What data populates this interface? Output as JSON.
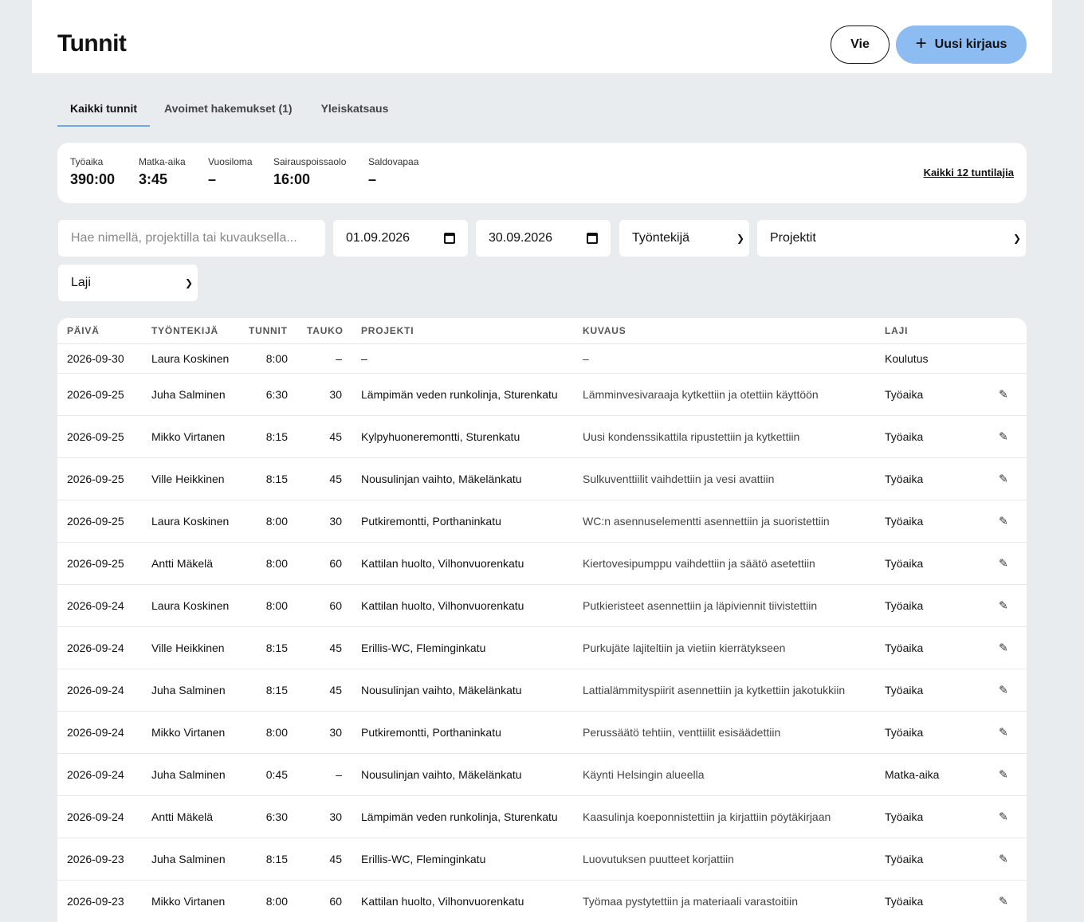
{
  "header": {
    "title": "Tunnit",
    "export_label": "Vie",
    "new_entry_label": "Uusi kirjaus",
    "plus_glyph": "+"
  },
  "tabs": [
    {
      "label": "Kaikki tunnit",
      "active": true
    },
    {
      "label": "Avoimet hakemukset (1)",
      "active": false
    },
    {
      "label": "Yleiskatsaus",
      "active": false
    }
  ],
  "summary": {
    "stats": [
      {
        "label": "Työaika",
        "value": "390:00"
      },
      {
        "label": "Matka-aika",
        "value": "3:45"
      },
      {
        "label": "Vuosiloma",
        "value": "–"
      },
      {
        "label": "Sairauspoissaolo",
        "value": "16:00"
      },
      {
        "label": "Saldovapaa",
        "value": "–"
      }
    ],
    "all_types_link": "Kaikki 12 tuntilajia"
  },
  "filters": {
    "search_placeholder": "Hae nimellä, projektilla tai kuvauksella...",
    "date_from": "01.09.2026",
    "date_to": "30.09.2026",
    "employee_select": "Työntekijä",
    "project_select": "Projektit",
    "type_select": "Laji"
  },
  "table": {
    "columns": [
      "PÄIVÄ",
      "TYÖNTEKIJÄ",
      "TUNNIT",
      "TAUKO",
      "PROJEKTI",
      "KUVAUS",
      "LAJI"
    ],
    "rows": [
      {
        "date": "2026-09-30",
        "employee": "Laura Koskinen",
        "hours": "8:00",
        "break": "–",
        "project": "–",
        "description": "–",
        "type": "Koulutus",
        "editable": false
      },
      {
        "date": "2026-09-25",
        "employee": "Juha Salminen",
        "hours": "6:30",
        "break": "30",
        "project": "Lämpimän veden runkolinja, Sturenkatu",
        "description": "Lämminvesivaraaja kytkettiin ja otettiin käyttöön",
        "type": "Työaika",
        "editable": true
      },
      {
        "date": "2026-09-25",
        "employee": "Mikko Virtanen",
        "hours": "8:15",
        "break": "45",
        "project": "Kylpyhuoneremontti, Sturenkatu",
        "description": "Uusi kondenssikattila ripustettiin ja kytkettiin",
        "type": "Työaika",
        "editable": true
      },
      {
        "date": "2026-09-25",
        "employee": "Ville Heikkinen",
        "hours": "8:15",
        "break": "45",
        "project": "Nousulinjan vaihto, Mäkelänkatu",
        "description": "Sulkuventtiilit vaihdettiin ja vesi avattiin",
        "type": "Työaika",
        "editable": true
      },
      {
        "date": "2026-09-25",
        "employee": "Laura Koskinen",
        "hours": "8:00",
        "break": "30",
        "project": "Putkiremontti, Porthaninkatu",
        "description": "WC:n asennuselementti asennettiin ja suoristettiin",
        "type": "Työaika",
        "editable": true
      },
      {
        "date": "2026-09-25",
        "employee": "Antti Mäkelä",
        "hours": "8:00",
        "break": "60",
        "project": "Kattilan huolto, Vilhonvuorenkatu",
        "description": "Kiertovesipumppu vaihdettiin ja säätö asetettiin",
        "type": "Työaika",
        "editable": true
      },
      {
        "date": "2026-09-24",
        "employee": "Laura Koskinen",
        "hours": "8:00",
        "break": "60",
        "project": "Kattilan huolto, Vilhonvuorenkatu",
        "description": "Putkieristeet asennettiin ja läpiviennit tiivistettiin",
        "type": "Työaika",
        "editable": true
      },
      {
        "date": "2026-09-24",
        "employee": "Ville Heikkinen",
        "hours": "8:15",
        "break": "45",
        "project": "Erillis-WC, Fleminginkatu",
        "description": "Purkujäte lajiteltiin ja vietiin kierrätykseen",
        "type": "Työaika",
        "editable": true
      },
      {
        "date": "2026-09-24",
        "employee": "Juha Salminen",
        "hours": "8:15",
        "break": "45",
        "project": "Nousulinjan vaihto, Mäkelänkatu",
        "description": "Lattialämmityspiirit asennettiin ja kytkettiin jakotukkiin",
        "type": "Työaika",
        "editable": true
      },
      {
        "date": "2026-09-24",
        "employee": "Mikko Virtanen",
        "hours": "8:00",
        "break": "30",
        "project": "Putkiremontti, Porthaninkatu",
        "description": "Perussäätö tehtiin, venttiilit esisäädettiin",
        "type": "Työaika",
        "editable": true
      },
      {
        "date": "2026-09-24",
        "employee": "Juha Salminen",
        "hours": "0:45",
        "break": "–",
        "project": "Nousulinjan vaihto, Mäkelänkatu",
        "description": "Käynti Helsingin alueella",
        "type": "Matka-aika",
        "editable": true
      },
      {
        "date": "2026-09-24",
        "employee": "Antti Mäkelä",
        "hours": "6:30",
        "break": "30",
        "project": "Lämpimän veden runkolinja, Sturenkatu",
        "description": "Kaasulinja koeponnistettiin ja kirjattiin pöytäkirjaan",
        "type": "Työaika",
        "editable": true
      },
      {
        "date": "2026-09-23",
        "employee": "Juha Salminen",
        "hours": "8:15",
        "break": "45",
        "project": "Erillis-WC, Fleminginkatu",
        "description": "Luovutuksen puutteet korjattiin",
        "type": "Työaika",
        "editable": true
      },
      {
        "date": "2026-09-23",
        "employee": "Mikko Virtanen",
        "hours": "8:00",
        "break": "60",
        "project": "Kattilan huolto, Vilhonvuorenkatu",
        "description": "Työmaa pystytettiin ja materiaali varastoitiin",
        "type": "Työaika",
        "editable": true
      }
    ]
  },
  "colors": {
    "background": "#e9ecef",
    "accent": "#8cbcf2",
    "tab_underline": "#6ea8e8"
  }
}
